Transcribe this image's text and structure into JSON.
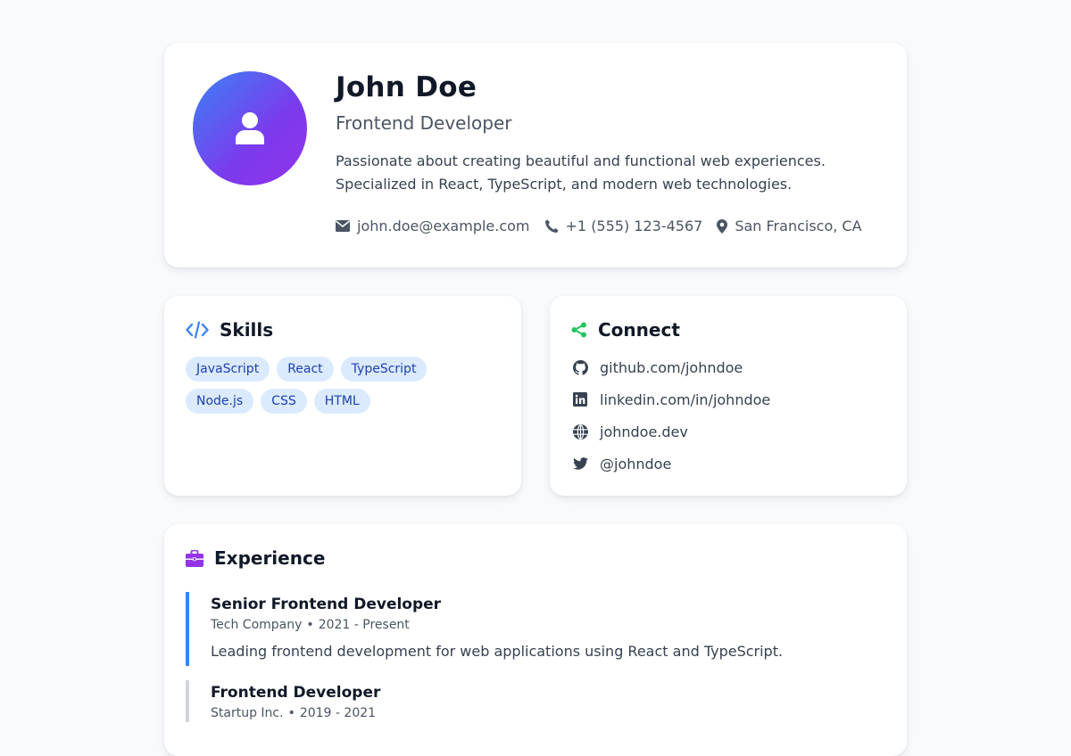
{
  "profile": {
    "name": "John Doe",
    "role": "Frontend Developer",
    "bio": "Passionate about creating beautiful and functional web experiences. Specialized in React, TypeScript, and modern web technologies.",
    "contacts": {
      "email": "john.doe@example.com",
      "phone": "+1 (555) 123-4567",
      "location": "San Francisco, CA"
    }
  },
  "skills": {
    "title": "Skills",
    "items": [
      "JavaScript",
      "React",
      "TypeScript",
      "Node.js",
      "CSS",
      "HTML"
    ]
  },
  "connect": {
    "title": "Connect",
    "links": [
      {
        "icon": "github-icon",
        "label": "github.com/johndoe"
      },
      {
        "icon": "linkedin-icon",
        "label": "linkedin.com/in/johndoe"
      },
      {
        "icon": "globe-icon",
        "label": "johndoe.dev"
      },
      {
        "icon": "twitter-icon",
        "label": "@johndoe"
      }
    ]
  },
  "experience": {
    "title": "Experience",
    "jobs": [
      {
        "title": "Senior Frontend Developer",
        "company": "Tech Company",
        "period": "2021 - Present",
        "description": "Leading frontend development for web applications using React and TypeScript."
      },
      {
        "title": "Frontend Developer",
        "company": "Startup Inc.",
        "period": "2019 - 2021"
      }
    ]
  },
  "colors": {
    "accent_blue": "#3b82f6",
    "accent_purple": "#9333ea",
    "connect_green": "#22c55e",
    "tag_bg": "#dbeafe",
    "tag_text": "#1e40af"
  }
}
